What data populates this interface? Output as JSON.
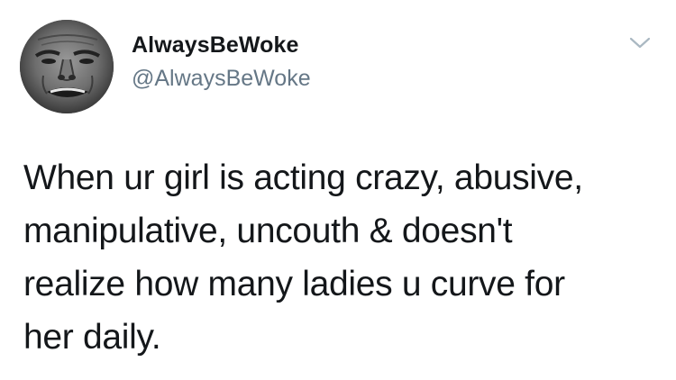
{
  "tweet": {
    "display_name": "AlwaysBeWoke",
    "handle": "@AlwaysBeWoke",
    "text": "When ur girl is acting crazy, abusive,\nmanipulative, uncouth & doesn't\nrealize how many ladies u curve for\nher daily.",
    "avatar_icon": "avatar-photo",
    "menu_icon": "chevron-down-icon"
  },
  "colors": {
    "name": "#14171a",
    "handle": "#657786",
    "caret": "#aab8c2",
    "background": "#ffffff"
  }
}
